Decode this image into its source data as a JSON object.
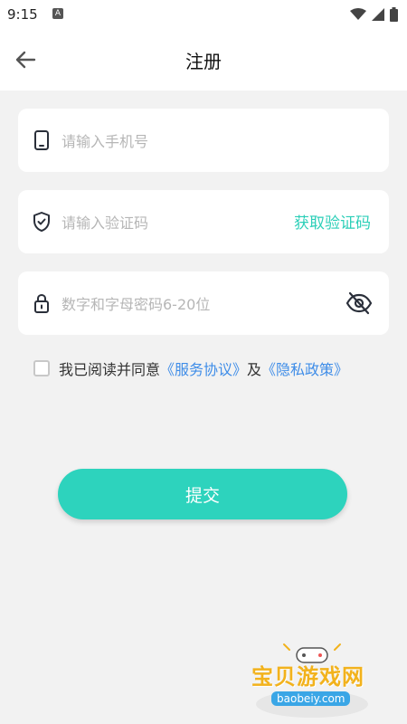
{
  "status_bar": {
    "time": "9:15",
    "app_icon_letter": "A",
    "icons": [
      "wifi-icon",
      "signal-icon",
      "battery-icon"
    ]
  },
  "header": {
    "title": "注册",
    "back_icon": "arrow-left-icon"
  },
  "form": {
    "phone": {
      "placeholder": "请输入手机号",
      "value": "",
      "icon": "phone-icon"
    },
    "code": {
      "placeholder": "请输入验证码",
      "value": "",
      "icon": "shield-check-icon",
      "get_code_label": "获取验证码"
    },
    "password": {
      "placeholder": "数字和字母密码6-20位",
      "value": "",
      "icon": "lock-icon",
      "toggle_icon": "eye-off-icon"
    }
  },
  "agreement": {
    "checked": false,
    "prefix": "我已阅读并同意",
    "service_link": "《服务协议》",
    "conjunction": "及",
    "privacy_link": "《隐私政策》"
  },
  "submit_label": "提交",
  "watermark": {
    "title": "宝贝游戏网",
    "url": "baobeiy.com"
  },
  "colors": {
    "accent": "#2dd3bd",
    "link": "#3f8de8",
    "background": "#f2f2f2"
  }
}
